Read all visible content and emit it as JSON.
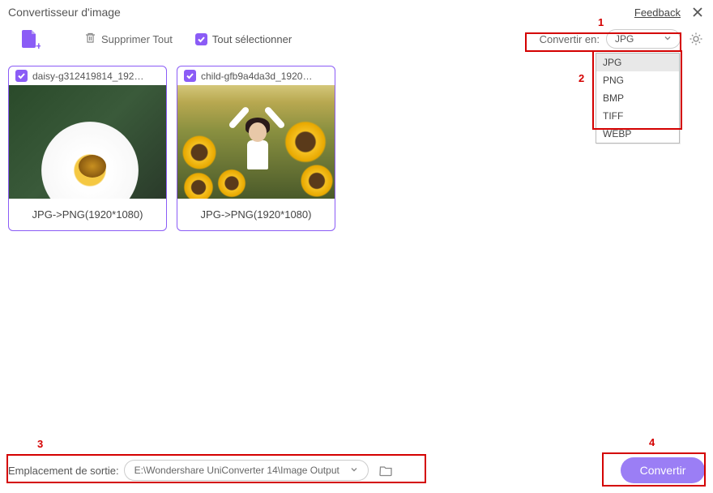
{
  "header": {
    "title": "Convertisseur d'image",
    "feedback": "Feedback"
  },
  "toolbar": {
    "delete_all": "Supprimer Tout",
    "select_all": "Tout sélectionner",
    "convert_label": "Convertir en:",
    "selected_format": "JPG"
  },
  "formats": [
    "JPG",
    "PNG",
    "BMP",
    "TIFF",
    "WEBP"
  ],
  "cards": [
    {
      "filename": "daisy-g312419814_192…",
      "conversion": "JPG->PNG(1920*1080)"
    },
    {
      "filename": "child-gfb9a4da3d_1920…",
      "conversion": "JPG->PNG(1920*1080)"
    }
  ],
  "output": {
    "label": "Emplacement de sortie:",
    "path": "E:\\Wondershare UniConverter 14\\Image Output"
  },
  "convert_button": "Convertir",
  "annotations": {
    "a1": "1",
    "a2": "2",
    "a3": "3",
    "a4": "4"
  }
}
